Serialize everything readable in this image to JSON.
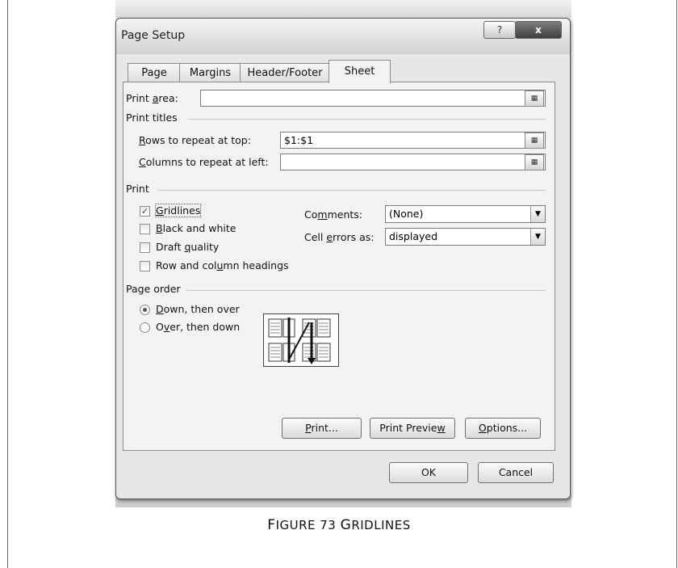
{
  "dialog": {
    "title": "Page Setup",
    "help_label": "?",
    "close_label": "x"
  },
  "tabs": [
    "Page",
    "Margins",
    "Header/Footer",
    "Sheet"
  ],
  "print_area": {
    "pre": "Print ",
    "key": "a",
    "post": "rea:",
    "value": ""
  },
  "print_titles": {
    "label": "Print titles",
    "rows": {
      "pre": "",
      "key": "R",
      "post": "ows to repeat at top:",
      "value": "$1:$1"
    },
    "cols": {
      "pre": "",
      "key": "C",
      "post": "olumns to repeat at left:",
      "value": ""
    }
  },
  "print_section": {
    "label": "Print",
    "gridlines": {
      "pre": "",
      "key": "G",
      "post": "ridlines",
      "checked": true,
      "mark": "✓"
    },
    "black_white": {
      "pre": "",
      "key": "B",
      "post": "lack and white",
      "checked": false
    },
    "draft": {
      "pre": "Draft ",
      "key": "q",
      "post": "uality",
      "checked": false
    },
    "headings": {
      "pre": "Row and col",
      "key": "u",
      "post": "mn headings",
      "checked": false
    },
    "comments": {
      "pre": "Co",
      "key": "m",
      "post": "ments:",
      "value": "(None)"
    },
    "cell_errors": {
      "pre": "Cell ",
      "key": "e",
      "post": "rrors as:",
      "value": "displayed"
    }
  },
  "page_order": {
    "label": "Page order",
    "down": {
      "pre": "",
      "key": "D",
      "post": "own, then over",
      "selected": true
    },
    "over": {
      "pre": "O",
      "key": "v",
      "post": "er, then down",
      "selected": false
    }
  },
  "buttons": {
    "print": {
      "pre": "",
      "key": "P",
      "post": "rint..."
    },
    "preview": {
      "pre": "Print Previe",
      "key": "w",
      "post": ""
    },
    "options": {
      "pre": "",
      "key": "O",
      "post": "ptions..."
    },
    "ok": "OK",
    "cancel": "Cancel"
  },
  "caption": {
    "first": "F",
    "rest1": "IGURE 73 ",
    "g": "G",
    "rest2": "RIDLINES"
  }
}
